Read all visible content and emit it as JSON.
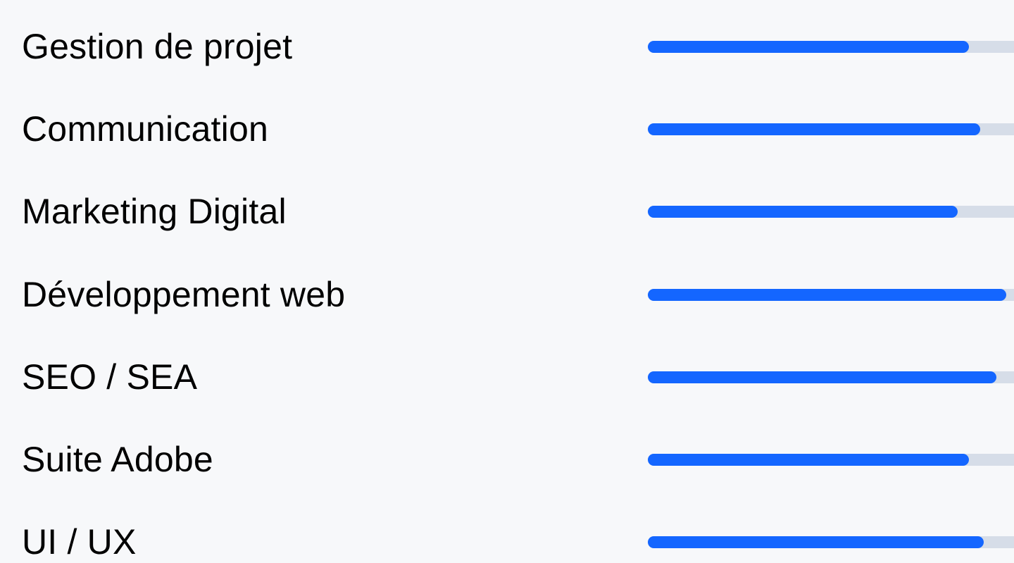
{
  "skills": [
    {
      "label": "Gestion de projet",
      "level": 0.815
    },
    {
      "label": "Communication",
      "level": 0.843
    },
    {
      "label": "Marketing Digital",
      "level": 0.786
    },
    {
      "label": "Développement web",
      "level": 0.909
    },
    {
      "label": "SEO / SEA",
      "level": 0.884
    },
    {
      "label": "Suite Adobe",
      "level": 0.815
    },
    {
      "label": "UI / UX",
      "level": 0.852
    }
  ],
  "colors": {
    "background": "#f7f8fa",
    "text": "#000000",
    "track": "#d6dde8",
    "fill": "#1466ff"
  }
}
